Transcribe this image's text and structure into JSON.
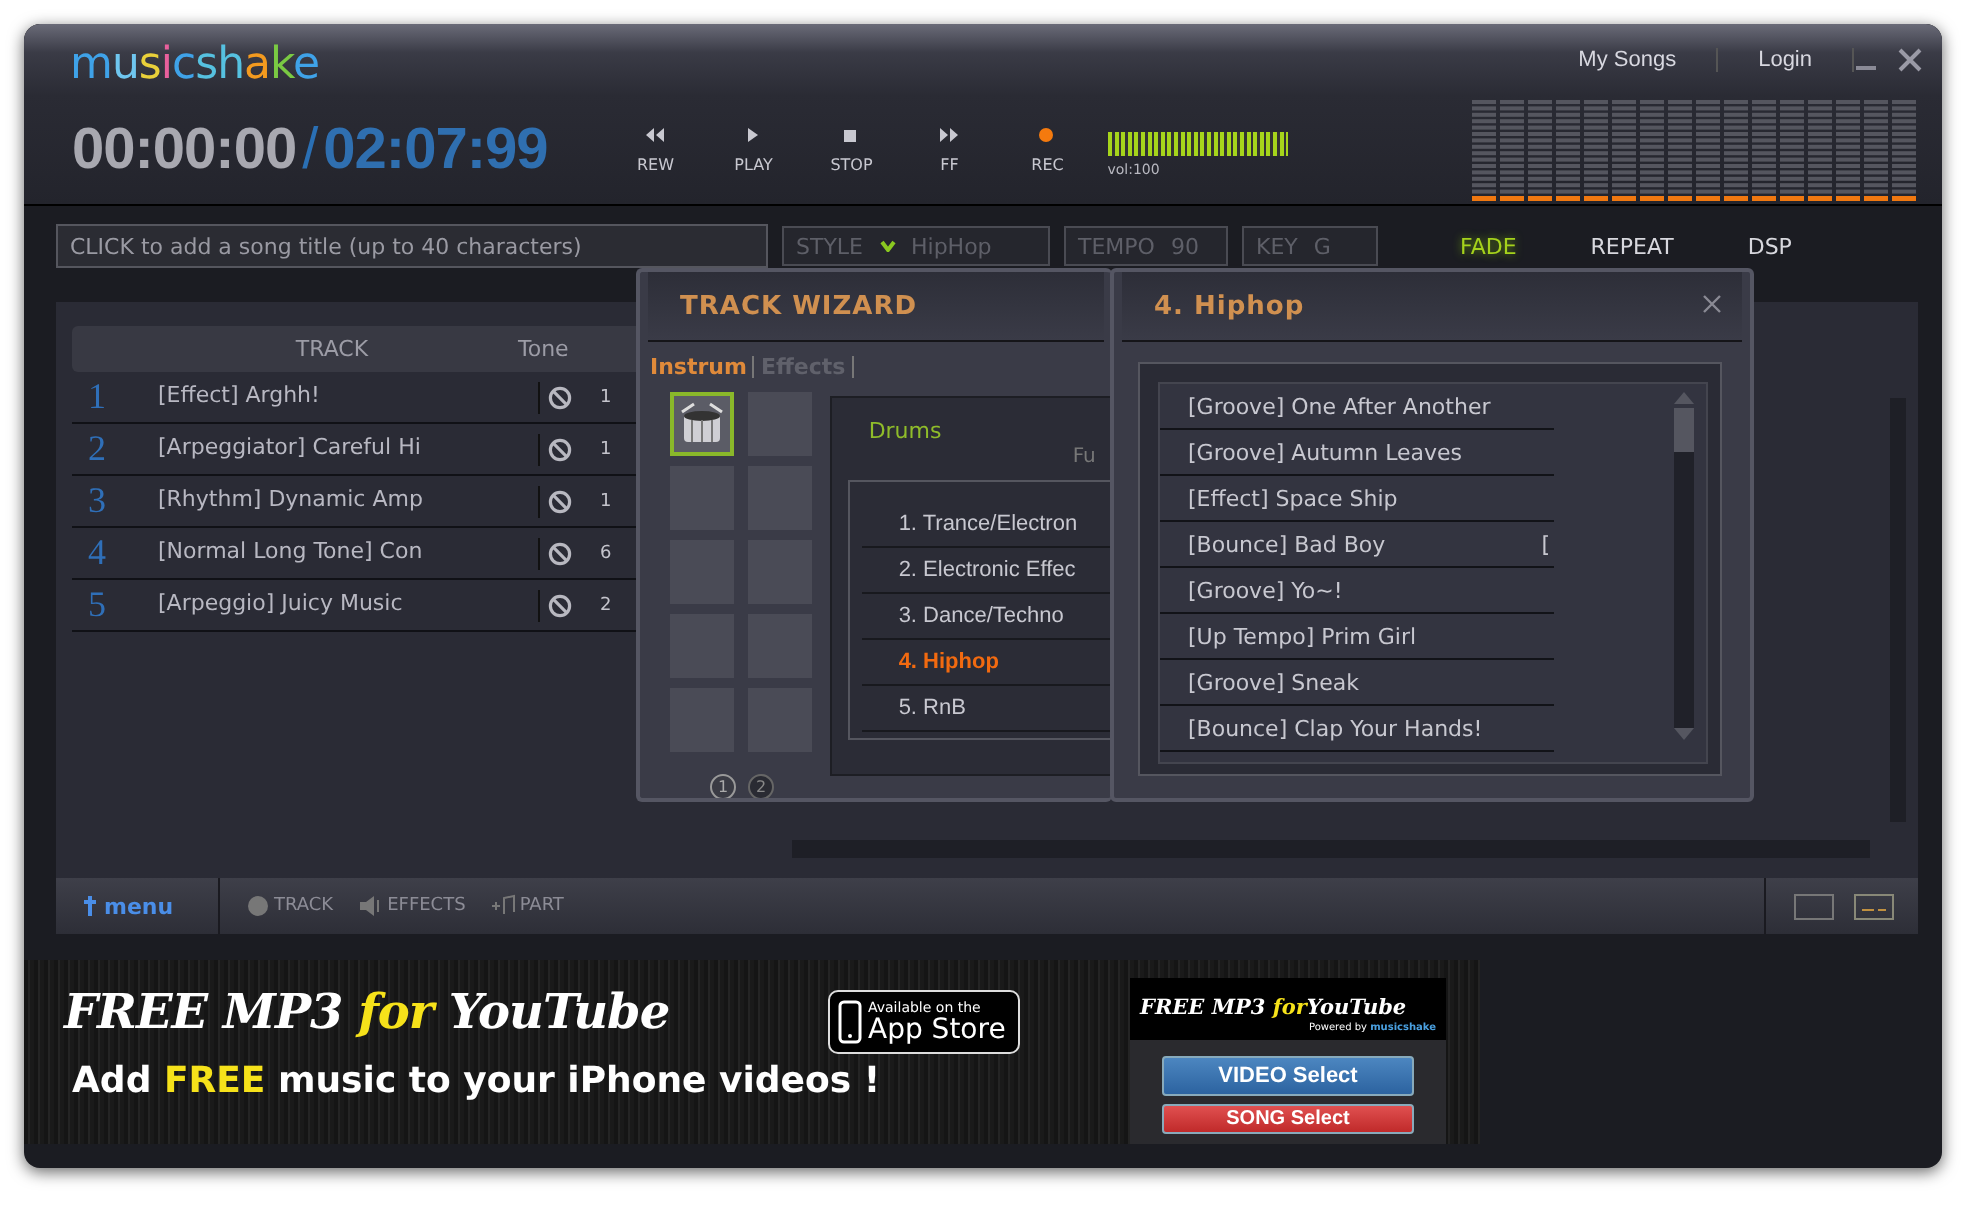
{
  "window": {
    "logo": "musicshake",
    "links": [
      {
        "label": "My Songs"
      },
      {
        "label": "Login"
      }
    ]
  },
  "transport": {
    "elapsed": "00:00:00",
    "separator": "/",
    "total": "02:07:99",
    "buttons": [
      {
        "kind": "rew",
        "label": "REW"
      },
      {
        "kind": "play",
        "label": "PLAY"
      },
      {
        "kind": "stop",
        "label": "STOP"
      },
      {
        "kind": "ff",
        "label": "FF"
      },
      {
        "kind": "rec",
        "label": "REC"
      }
    ],
    "volume": {
      "level": 1,
      "reading": "vol:100"
    }
  },
  "song": {
    "title_placeholder": "CLICK to add a song title (up to 40 characters)",
    "style": {
      "label": "STYLE",
      "value": "HipHop"
    },
    "tempo": {
      "label": "TEMPO",
      "value": "90"
    },
    "key": {
      "label": "KEY",
      "value": "G"
    },
    "toggles": [
      {
        "label": "FADE",
        "on": true
      },
      {
        "label": "REPEAT",
        "on": false
      },
      {
        "label": "DSP",
        "on": false
      }
    ]
  },
  "tracks": {
    "columns": [
      "TRACK",
      "Tone"
    ],
    "rows": [
      {
        "number": "1",
        "name": "[Effect] Arghh!",
        "tone": "1"
      },
      {
        "number": "2",
        "name": "[Arpeggiator] Careful Hi",
        "tone": "1"
      },
      {
        "number": "3",
        "name": "[Rhythm] Dynamic Amp",
        "tone": "1"
      },
      {
        "number": "4",
        "name": "[Normal Long Tone] Con",
        "tone": "6"
      },
      {
        "number": "5",
        "name": "[Arpeggio] Juicy Music",
        "tone": "2"
      }
    ]
  },
  "track_wizard": {
    "title": "TRACK WIZARD",
    "tabs": [
      {
        "label": "Instrum",
        "selected": true
      },
      {
        "label": "Effects",
        "selected": false
      }
    ],
    "slots": [
      {
        "kind": "drums",
        "selected": true
      },
      {
        "kind": "empty",
        "selected": false
      },
      {
        "kind": "empty",
        "selected": false
      },
      {
        "kind": "empty",
        "selected": false
      },
      {
        "kind": "empty",
        "selected": false
      },
      {
        "kind": "empty",
        "selected": false
      },
      {
        "kind": "empty",
        "selected": false
      },
      {
        "kind": "empty",
        "selected": false
      },
      {
        "kind": "empty",
        "selected": false
      },
      {
        "kind": "empty",
        "selected": false
      }
    ],
    "pages": [
      {
        "label": "1",
        "selected": true
      },
      {
        "label": "2",
        "selected": false
      }
    ],
    "category": "Drums",
    "category_2": "Fu",
    "genres": [
      {
        "label": "1. Trance/Electron",
        "selected": false
      },
      {
        "label": "2. Electronic Effec",
        "selected": false
      },
      {
        "label": "3. Dance/Techno",
        "selected": false
      },
      {
        "label": "4. Hiphop",
        "selected": true
      },
      {
        "label": "5. RnB",
        "selected": false
      }
    ]
  },
  "genre_panel": {
    "title": "4. Hiphop",
    "items": [
      {
        "label": "[Groove] One After Another"
      },
      {
        "label": "[Groove] Autumn Leaves"
      },
      {
        "label": "[Effect] Space Ship"
      },
      {
        "label": "[Bounce] Bad Boy",
        "extra": "["
      },
      {
        "label": "[Groove] Yo~!"
      },
      {
        "label": "[Up Tempo] Prim Girl"
      },
      {
        "label": "[Groove] Sneak"
      },
      {
        "label": "[Bounce] Clap Your Hands!"
      }
    ]
  },
  "toolbar": {
    "menu": "menu",
    "tools": [
      {
        "kind": "track",
        "label": "TRACK"
      },
      {
        "kind": "effects",
        "label": "EFFECTS"
      },
      {
        "kind": "part",
        "label": "PART"
      }
    ]
  },
  "ad": {
    "headline": [
      {
        "text": "FREE MP3 ",
        "highlight": false
      },
      {
        "text": "for",
        "highlight": true
      },
      {
        "text": " YouTube",
        "highlight": false
      }
    ],
    "subline": [
      {
        "text": "Add ",
        "highlight": false
      },
      {
        "text": "FREE",
        "highlight": true
      },
      {
        "text": " music to your iPhone videos !",
        "highlight": false
      }
    ],
    "badge": {
      "top": "Available on the",
      "bottom": "App Store"
    },
    "widget": {
      "title": [
        {
          "text": "FREE MP3 ",
          "highlight": false
        },
        {
          "text": "for",
          "highlight": true
        },
        {
          "text": "YouTube",
          "highlight": false
        }
      ],
      "powered": "Powered by",
      "brand": "musicshake",
      "buttons": [
        {
          "kind": "video",
          "label": "VIDEO Select"
        },
        {
          "kind": "song",
          "label": "SONG Select"
        }
      ]
    }
  }
}
